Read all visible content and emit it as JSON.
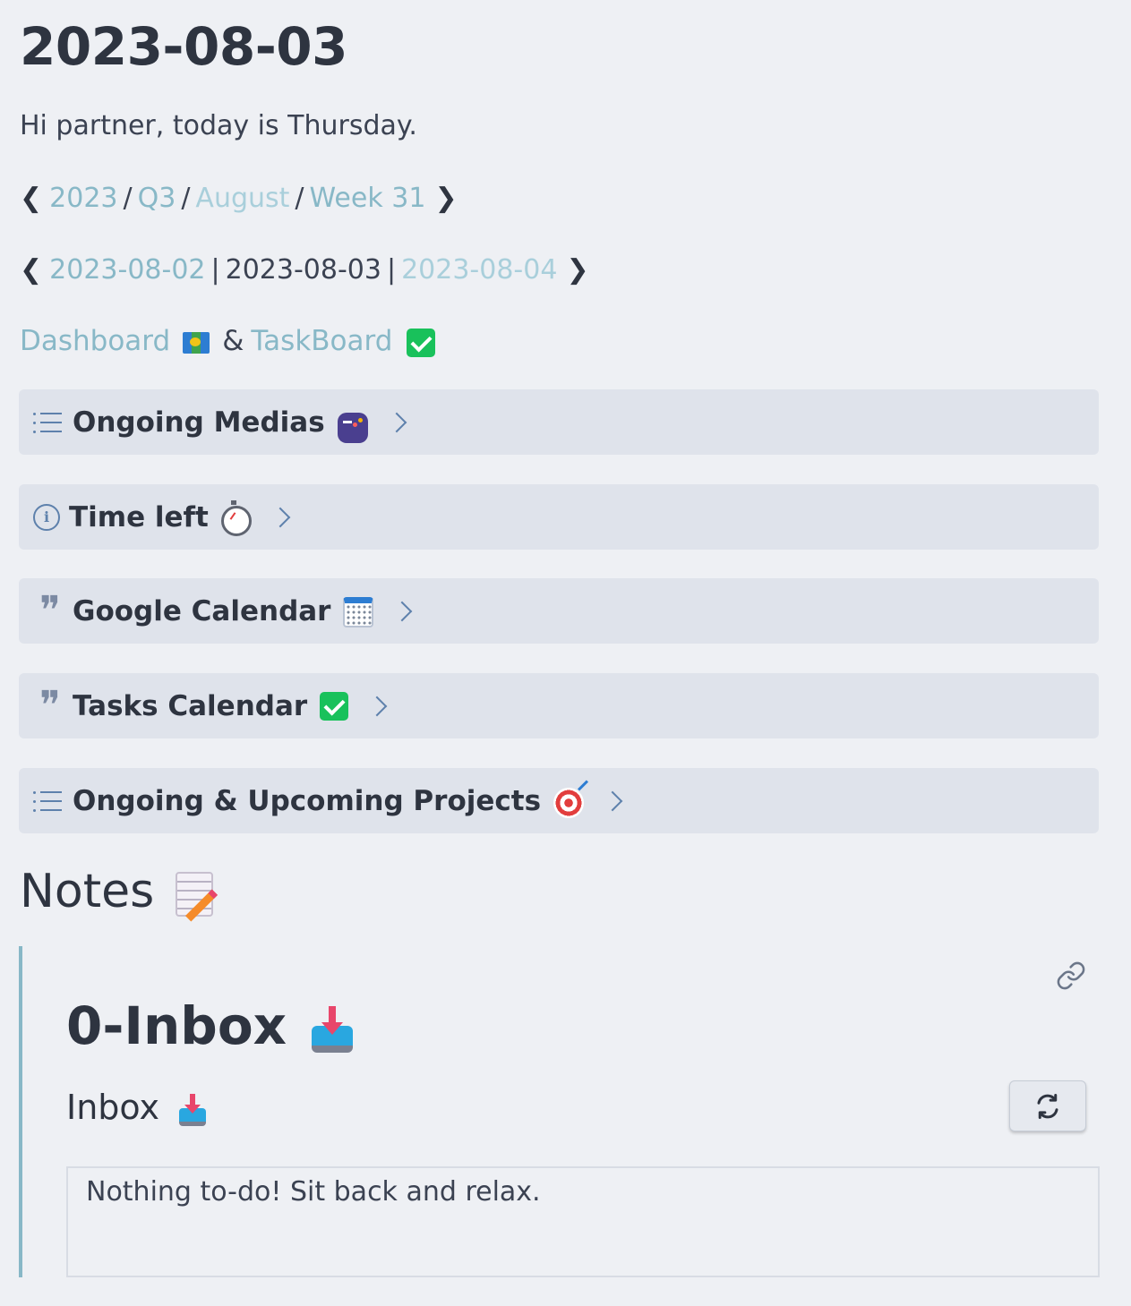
{
  "page": {
    "title": "2023-08-03",
    "greeting": "Hi partner, today is Thursday."
  },
  "period_nav": {
    "prev_arrow": "❮",
    "next_arrow": "❯",
    "year": "2023",
    "quarter": "Q3",
    "month": "August",
    "week": "Week 31",
    "separator": "/"
  },
  "day_nav": {
    "prev_arrow": "❮",
    "next_arrow": "❯",
    "previous_day": "2023-08-02",
    "current_day": "2023-08-03",
    "next_day": "2023-08-04",
    "separator": "|"
  },
  "boards": {
    "dashboard_label": "Dashboard",
    "dashboard_icon": "world-map-icon",
    "connector": "&",
    "taskboard_label": "TaskBoard",
    "taskboard_icon": "check-mark-button-icon"
  },
  "callouts": [
    {
      "title": "Ongoing Medias",
      "type_icon": "list-icon",
      "emoji": "video-game-icon"
    },
    {
      "title": "Time left",
      "type_icon": "info-icon",
      "emoji": "stopwatch-icon"
    },
    {
      "title": "Google Calendar",
      "type_icon": "quote-icon",
      "emoji": "spiral-calendar-icon"
    },
    {
      "title": "Tasks Calendar",
      "type_icon": "quote-icon",
      "emoji": "check-mark-button-icon"
    },
    {
      "title": "Ongoing & Upcoming Projects",
      "type_icon": "list-icon",
      "emoji": "direct-hit-icon"
    }
  ],
  "notes": {
    "heading": "Notes",
    "emoji": "memo-icon"
  },
  "embed": {
    "title": "0-Inbox",
    "title_emoji": "inbox-tray-icon",
    "section_heading": "Inbox",
    "section_emoji": "inbox-tray-icon",
    "empty_message": "Nothing to-do! Sit back and relax.",
    "link_icon": "link-icon",
    "refresh_icon": "refresh-icon"
  },
  "colors": {
    "background": "#eef0f4",
    "callout_background": "#dfe3eb",
    "link": "#88b8c7",
    "accent_icon": "#5e81ac",
    "embed_border": "#88b8c7",
    "check_green": "#19c15b"
  }
}
